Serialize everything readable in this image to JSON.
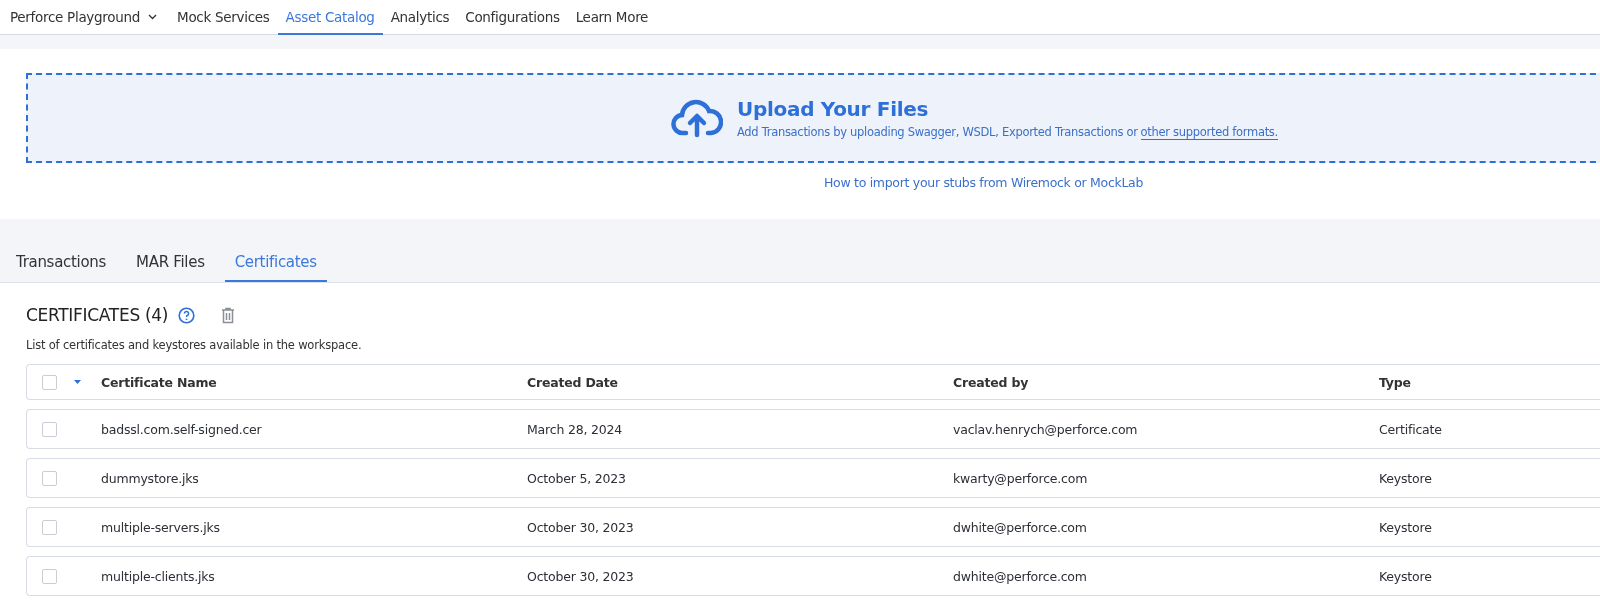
{
  "nav": {
    "workspace": "Perforce Playground",
    "items": [
      {
        "label": "Mock Services",
        "selected": false
      },
      {
        "label": "Asset Catalog",
        "selected": true
      },
      {
        "label": "Analytics",
        "selected": false
      },
      {
        "label": "Configurations",
        "selected": false
      },
      {
        "label": "Learn More",
        "selected": false
      }
    ]
  },
  "upload": {
    "title": "Upload Your Files",
    "description": "Add Transactions by uploading Swagger, WSDL, Exported Transactions or",
    "formats_link": "other supported formats.",
    "import_link": "How to import your stubs from Wiremock or MockLab"
  },
  "tabs": [
    {
      "label": "Transactions",
      "selected": false
    },
    {
      "label": "MAR Files",
      "selected": false
    },
    {
      "label": "Certificates",
      "selected": true
    }
  ],
  "section": {
    "title": "CERTIFICATES (4)",
    "description": "List of certificates and keystores available in the workspace."
  },
  "table": {
    "select_all": {
      "checked": false
    },
    "columns": [
      "Certificate Name",
      "Created Date",
      "Created by",
      "Type"
    ],
    "rows": [
      {
        "checked": false,
        "cells": [
          "badssl.com.self-signed.cer",
          "March 28, 2024",
          "vaclav.henrych@perforce.com",
          "Certificate"
        ]
      },
      {
        "checked": false,
        "cells": [
          "dummystore.jks",
          "October 5, 2023",
          "kwarty@perforce.com",
          "Keystore"
        ]
      },
      {
        "checked": false,
        "cells": [
          "multiple-servers.jks",
          "October 30, 2023",
          "dwhite@perforce.com",
          "Keystore"
        ]
      },
      {
        "checked": false,
        "cells": [
          "multiple-clients.jks",
          "October 30, 2023",
          "dwhite@perforce.com",
          "Keystore"
        ]
      }
    ]
  }
}
